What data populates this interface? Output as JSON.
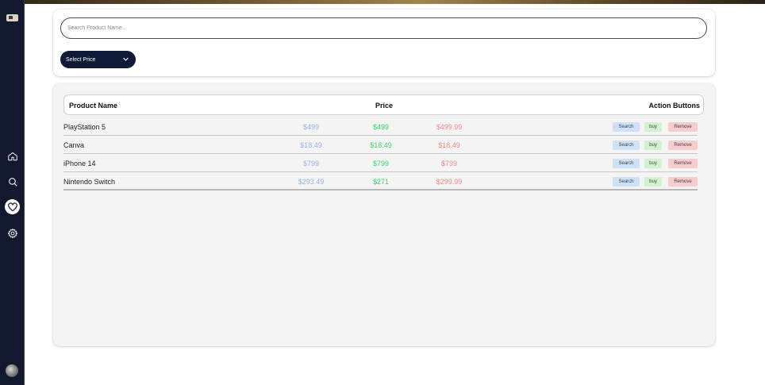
{
  "search": {
    "placeholder": "Search Product Name..."
  },
  "filter": {
    "select_label": "Select Price"
  },
  "table": {
    "headers": {
      "name": "Product Name",
      "price": "Price",
      "actions": "Action Buttons"
    },
    "rows": [
      {
        "name": "PlayStation 5",
        "price_1": "$499",
        "price_2": "$499",
        "price_3": "$499.99"
      },
      {
        "name": "Canva",
        "price_1": "$18.49",
        "price_2": "$18.49",
        "price_3": "$18.49"
      },
      {
        "name": "iPhone 14",
        "price_1": "$799",
        "price_2": "$799",
        "price_3": "$799"
      },
      {
        "name": "Nintendo Switch",
        "price_1": "$293.49",
        "price_2": "$271",
        "price_3": "$299.99"
      }
    ],
    "buttons": {
      "search": "Search",
      "buy": "buy",
      "remove": "Remove"
    }
  },
  "sidebar": {
    "items": [
      {
        "icon": "home-icon"
      },
      {
        "icon": "search-icon"
      },
      {
        "icon": "heart-icon",
        "active": true
      },
      {
        "icon": "gear-icon"
      }
    ]
  },
  "colors": {
    "sidebar": "#10192e",
    "select_bg": "#0f1a36",
    "price_1": "#9bb0e6",
    "price_2": "#3fd36a",
    "price_3": "#f08a8a",
    "btn_search": "#cfe1f7",
    "btn_buy": "#d2f1cf",
    "btn_remove": "#f6cccc"
  }
}
